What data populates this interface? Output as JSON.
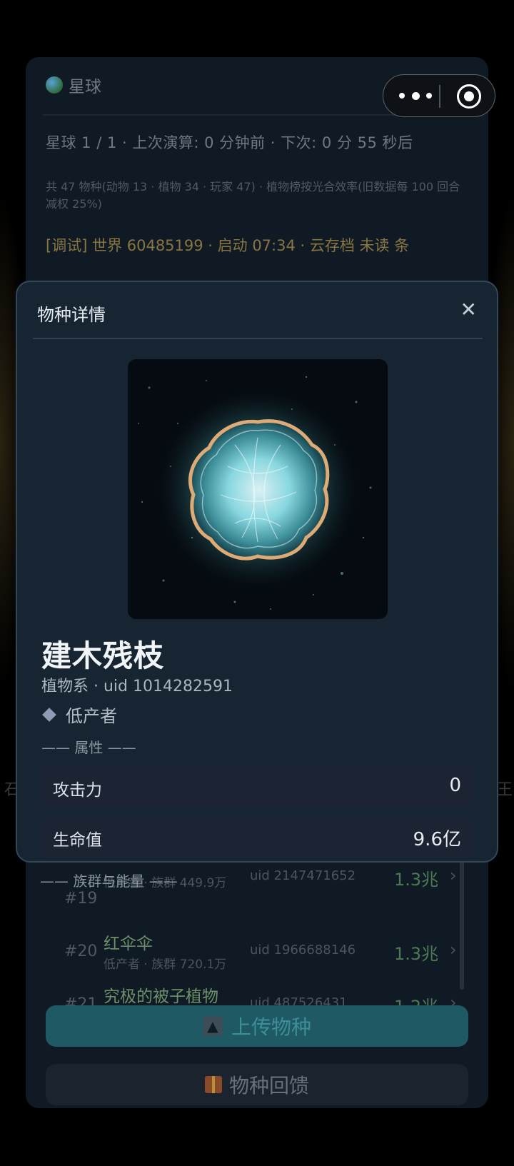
{
  "planet_panel": {
    "title": "星球",
    "close_glyph": "✕",
    "status_line": "星球 1 / 1 · 上次演算: 0 分钟前 · 下次: 0 分 55 秒后",
    "summary_line": "共 47 物种(动物 13 · 植物 34 · 玩家 47) · 植物榜按光合效率(旧数据每 100 回合减权 25%)",
    "debug_line": "[调试] 世界 60485199 · 启动 07:34 · 云存档 未读 条"
  },
  "side_chars": {
    "left": "石",
    "right": "王"
  },
  "ranking": [
    {
      "rank": "#19",
      "name": "",
      "sub": "低产者 · 族群 449.9万",
      "uid": "uid 2147471652",
      "value": "1.3兆"
    },
    {
      "rank": "#20",
      "name": "红伞伞",
      "sub": "低产者 · 族群 720.1万",
      "uid": "uid 1966688146",
      "value": "1.3兆"
    },
    {
      "rank": "#21",
      "name": "究极的被子植物",
      "sub": "",
      "uid": "uid 487526431",
      "value": "1.2兆"
    }
  ],
  "buttons": {
    "upload": "上传物种",
    "feedback": "物种回馈"
  },
  "modal": {
    "title": "物种详情",
    "close_glyph": "✕",
    "species_name": "建木残枝",
    "meta": "植物系 · uid 1014282591",
    "role": "低产者",
    "section_attributes": "—— 属性 ——",
    "section_population": "—— 族群与能量 ——",
    "attributes": [
      {
        "label": "攻击力",
        "value": "0"
      },
      {
        "label": "生命值",
        "value": "9.6亿"
      }
    ]
  },
  "icons": {
    "globe": "globe-icon",
    "more": "more-dots-icon",
    "target": "target-icon",
    "upload": "upload-icon",
    "gift": "gift-icon",
    "diamond": "diamond-icon",
    "chevron": "chevron-right-icon"
  },
  "colors": {
    "background": "#000000",
    "panel": "#0f1a24",
    "modal": "#172532",
    "upload_button": "#1f5a64",
    "debug_text": "#8a7540",
    "rank_value": "#4c7a54"
  }
}
